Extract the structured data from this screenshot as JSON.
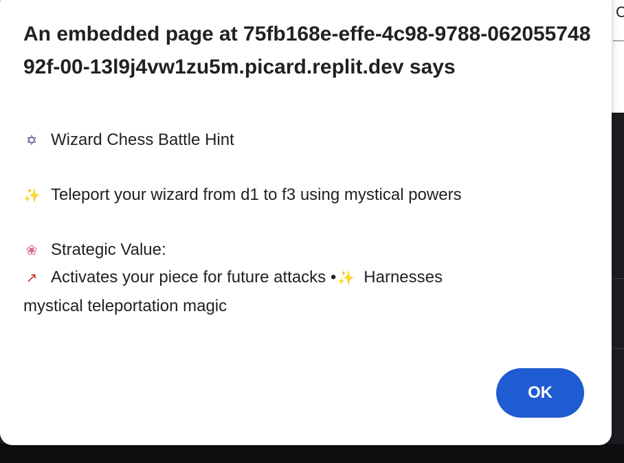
{
  "dialog": {
    "title": "An embedded page at 75fb168e-effe-4c98-9788-06205574892f-00-13l9j4vw1zu5m.picard.replit.dev says",
    "hint_title": "Wizard Chess Battle Hint",
    "move_text": "Teleport your wizard from d1 to f3 using mystical powers",
    "strategic_label": "Strategic Value:",
    "value_line_1a": "Activates your piece for future attacks •",
    "value_line_1b": "Harnesses",
    "value_line_2": "mystical teleportation magic",
    "ok_label": "OK"
  },
  "icons": {
    "wizard": "wizard-emoji",
    "sparkles": "sparkles-emoji",
    "brain": "brain-emoji",
    "chart": "chart-increasing-emoji"
  },
  "colors": {
    "ok_button": "#1f5bd1",
    "dialog_bg": "#ffffff",
    "backdrop": "#202124"
  }
}
